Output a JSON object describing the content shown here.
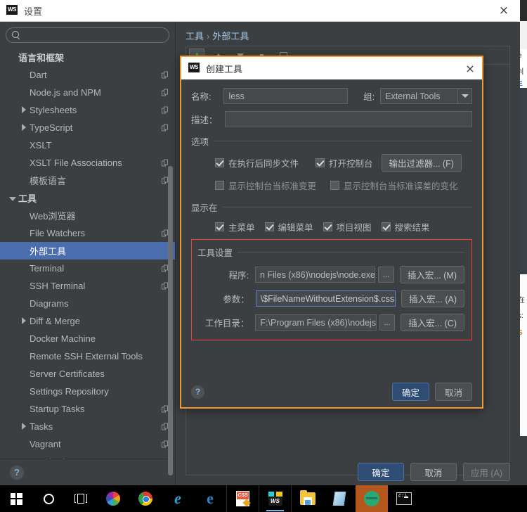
{
  "window": {
    "title": "设置",
    "logo_text": "WS",
    "close_icon": "×"
  },
  "sidebar": {
    "search": {
      "value": "",
      "placeholder": ""
    },
    "items": [
      {
        "label": "语言和框架",
        "indent": 0,
        "arrow": "none",
        "group": true,
        "copy": false,
        "selected": false
      },
      {
        "label": "Dart",
        "indent": 1,
        "arrow": "none",
        "group": false,
        "copy": true,
        "selected": false
      },
      {
        "label": "Node.js and NPM",
        "indent": 1,
        "arrow": "none",
        "group": false,
        "copy": true,
        "selected": false
      },
      {
        "label": "Stylesheets",
        "indent": 1,
        "arrow": "closed",
        "group": false,
        "copy": true,
        "selected": false
      },
      {
        "label": "TypeScript",
        "indent": 1,
        "arrow": "closed",
        "group": false,
        "copy": true,
        "selected": false
      },
      {
        "label": "XSLT",
        "indent": 1,
        "arrow": "none",
        "group": false,
        "copy": false,
        "selected": false
      },
      {
        "label": "XSLT File Associations",
        "indent": 1,
        "arrow": "none",
        "group": false,
        "copy": true,
        "selected": false
      },
      {
        "label": "模板语言",
        "indent": 1,
        "arrow": "none",
        "group": false,
        "copy": true,
        "selected": false
      },
      {
        "label": "工具",
        "indent": 0,
        "arrow": "open",
        "group": true,
        "copy": false,
        "selected": false
      },
      {
        "label": "Web浏览器",
        "indent": 1,
        "arrow": "none",
        "group": false,
        "copy": false,
        "selected": false
      },
      {
        "label": "File Watchers",
        "indent": 1,
        "arrow": "none",
        "group": false,
        "copy": true,
        "selected": false
      },
      {
        "label": "外部工具",
        "indent": 1,
        "arrow": "none",
        "group": false,
        "copy": false,
        "selected": true
      },
      {
        "label": "Terminal",
        "indent": 1,
        "arrow": "none",
        "group": false,
        "copy": true,
        "selected": false
      },
      {
        "label": "SSH Terminal",
        "indent": 1,
        "arrow": "none",
        "group": false,
        "copy": true,
        "selected": false
      },
      {
        "label": "Diagrams",
        "indent": 1,
        "arrow": "none",
        "group": false,
        "copy": false,
        "selected": false
      },
      {
        "label": "Diff & Merge",
        "indent": 1,
        "arrow": "closed",
        "group": false,
        "copy": false,
        "selected": false
      },
      {
        "label": "Docker Machine",
        "indent": 1,
        "arrow": "none",
        "group": false,
        "copy": false,
        "selected": false
      },
      {
        "label": "Remote SSH External Tools",
        "indent": 1,
        "arrow": "none",
        "group": false,
        "copy": false,
        "selected": false
      },
      {
        "label": "Server Certificates",
        "indent": 1,
        "arrow": "none",
        "group": false,
        "copy": false,
        "selected": false
      },
      {
        "label": "Settings Repository",
        "indent": 1,
        "arrow": "none",
        "group": false,
        "copy": false,
        "selected": false
      },
      {
        "label": "Startup Tasks",
        "indent": 1,
        "arrow": "none",
        "group": false,
        "copy": true,
        "selected": false
      },
      {
        "label": "Tasks",
        "indent": 1,
        "arrow": "closed",
        "group": false,
        "copy": true,
        "selected": false
      },
      {
        "label": "Vagrant",
        "indent": 1,
        "arrow": "none",
        "group": false,
        "copy": true,
        "selected": false
      },
      {
        "label": "XPath Viewer",
        "indent": 1,
        "arrow": "none",
        "group": false,
        "copy": false,
        "selected": false
      }
    ],
    "help_label": "?"
  },
  "content": {
    "breadcrumb": {
      "parent": "工具",
      "separator": "›",
      "current": "外部工具"
    }
  },
  "dialog": {
    "logo_text": "WS",
    "title": "创建工具",
    "close_icon": "×",
    "name_label": "名称:",
    "name_value": "less",
    "group_label": "组:",
    "group_value": "External Tools",
    "desc_label": "描述：",
    "desc_value": "",
    "options": {
      "section_title": "选项",
      "sync_files": {
        "label": "在执行后同步文件",
        "checked": true
      },
      "open_console": {
        "label": "打开控制台",
        "checked": true
      },
      "output_filters_button": "输出过滤器... (F)",
      "show_console_stdout": {
        "label": "显示控制台当标准变更",
        "checked": false
      },
      "show_console_stderr": {
        "label": "显示控制台当标准误差的变化",
        "checked": false
      }
    },
    "show_in": {
      "section_title": "显示在",
      "items": [
        {
          "label": "主菜单",
          "checked": true
        },
        {
          "label": "编辑菜单",
          "checked": true
        },
        {
          "label": "项目视图",
          "checked": true
        },
        {
          "label": "搜索结果",
          "checked": true
        }
      ]
    },
    "tool_settings": {
      "section_title": "工具设置",
      "program_label": "程序:",
      "program_value": "n Files (x86)\\nodejs\\node.exe",
      "program_macro_button": "插入宏... (M)",
      "arguments_label": "参数：",
      "arguments_value": "\\$FileNameWithoutExtension$.css",
      "arguments_macro_button": "插入宏... (A)",
      "workdir_label": "工作目录：",
      "workdir_value": "F:\\Program Files (x86)\\nodejs",
      "workdir_macro_button": "插入宏... (C)",
      "browse_label": "...",
      "highlight_color": "#e8453c"
    },
    "help_label": "?",
    "ok_button": "确定",
    "cancel_button": "取消",
    "border_color": "#f09a2a"
  },
  "main_footer": {
    "ok_button": "确定",
    "cancel_button": "取消",
    "apply_button": "应用 (A)"
  },
  "taskbar": {
    "items": [
      {
        "name": "start-button",
        "icon": "windows-logo-icon"
      },
      {
        "name": "cortana-button",
        "icon": "cortana-circle-icon"
      },
      {
        "name": "task-view-button",
        "icon": "task-view-icon"
      },
      {
        "name": "pinwheel-app",
        "icon": "pinwheel-icon"
      },
      {
        "name": "chrome-app",
        "icon": "chrome-icon"
      },
      {
        "name": "internet-explorer-app",
        "icon": "internet-explorer-icon"
      },
      {
        "name": "edge-app",
        "icon": "edge-icon"
      },
      {
        "name": "css-editor-app",
        "icon": "css-file-icon"
      },
      {
        "name": "webstorm-app",
        "icon": "webstorm-icon"
      },
      {
        "name": "file-explorer-app",
        "icon": "folder-icon"
      },
      {
        "name": "notepad-app",
        "icon": "notepad-icon"
      },
      {
        "name": "green-app",
        "icon": "green-circle-icon"
      },
      {
        "name": "command-prompt-app",
        "icon": "command-prompt-icon"
      }
    ]
  },
  "background_window": {
    "fragments": [
      "e",
      "n|",
      "在",
      "E",
      "s:",
      "S"
    ]
  }
}
